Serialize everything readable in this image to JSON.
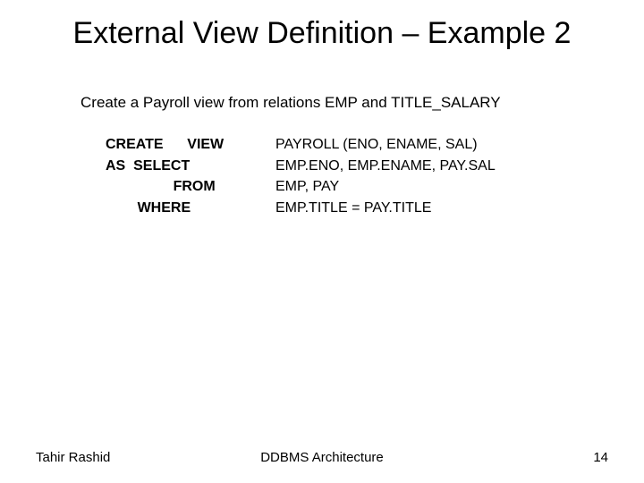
{
  "title": "External View Definition – Example 2",
  "intro": "Create a Payroll view from relations EMP and TITLE_SALARY",
  "sql": {
    "rows": [
      {
        "keyword": "CREATE      VIEW",
        "value": "PAYROLL (ENO, ENAME, SAL)"
      },
      {
        "keyword": "AS  SELECT",
        "value": "EMP.ENO, EMP.ENAME, PAY.SAL"
      },
      {
        "keyword": "                 FROM",
        "value": "EMP, PAY"
      },
      {
        "keyword": "        WHERE",
        "value": "EMP.TITLE = PAY.TITLE"
      }
    ]
  },
  "footer": {
    "author": "Tahir Rashid",
    "topic": "DDBMS Architecture",
    "page": "14"
  }
}
